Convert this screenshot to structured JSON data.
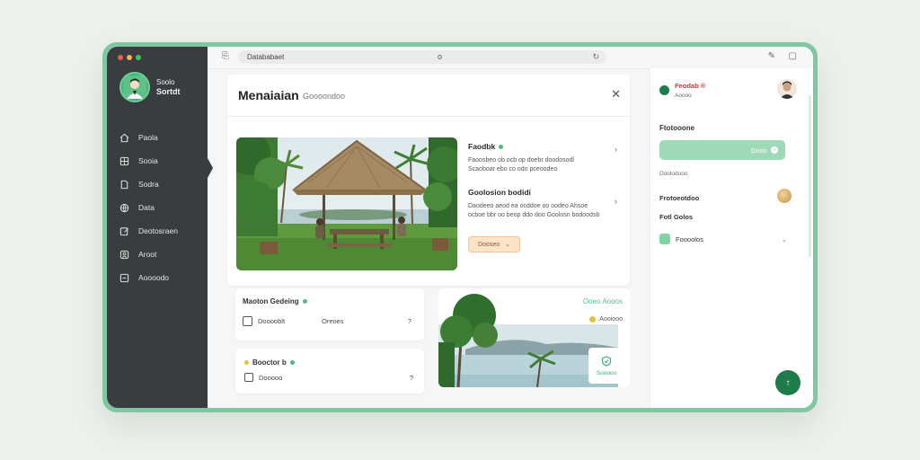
{
  "window": {
    "dot_colors": [
      "#f05a4f",
      "#f5b43a",
      "#45c162"
    ],
    "address_text": "Datababaet",
    "address_mid": "o",
    "refresh_icon": "refresh-icon"
  },
  "sidebar": {
    "profile_line1": "Soolo",
    "profile_line2": "Sortdt",
    "items": [
      {
        "label": "Paola",
        "icon": "home-icon"
      },
      {
        "label": "Sooia",
        "icon": "grid-icon"
      },
      {
        "label": "Sodra",
        "icon": "document-icon"
      },
      {
        "label": "Data",
        "icon": "globe-icon"
      },
      {
        "label": "Deotosraen",
        "icon": "edit-icon"
      },
      {
        "label": "Aroot",
        "icon": "user-icon"
      },
      {
        "label": "Aoooodo",
        "icon": "layers-icon"
      }
    ]
  },
  "main": {
    "title": "Menaiaian",
    "subtitle": "Goooondoo",
    "info1_title": "Faodbk",
    "info1_text": "Faoosbeo ob ocb op doebr doodosodl Scaoboar ebo co odo pceoodeo",
    "info2_title": "Goolosion bodidi",
    "info2_text": "Daodeeo aeod ea ocddoe oo oodeo Ahsoe ocboe bbr oo beop ddo doo Goolosn bodoodsb",
    "pill_label": "Dooseo"
  },
  "card_a": {
    "title": "Maoton Gedeing",
    "row_label": "Dooooblt",
    "row_value": "Oreoes",
    "row_end": "?"
  },
  "card_b": {
    "title": "Booctor b",
    "row_label": "Dooooo",
    "row_end": "?"
  },
  "photo_card": {
    "title": "Ooeo Aooos",
    "subtitle": "Aooiooo",
    "badge": "Sooooo"
  },
  "right_panel": {
    "title": "Feodab ®",
    "subtitle": "Aoooo",
    "section1": "Ftotooone",
    "button_label": "Gooo",
    "caption": "Dooloduoo",
    "section2": "Frotoeotdoo",
    "section3": "Fotl Golos",
    "row_label": "Foooolos"
  },
  "colors": {
    "accent": "#4cbf7f",
    "sidebar_bg": "#3a3d40",
    "fab": "#1e7b4a",
    "pill_bg": "#fde3c7"
  }
}
